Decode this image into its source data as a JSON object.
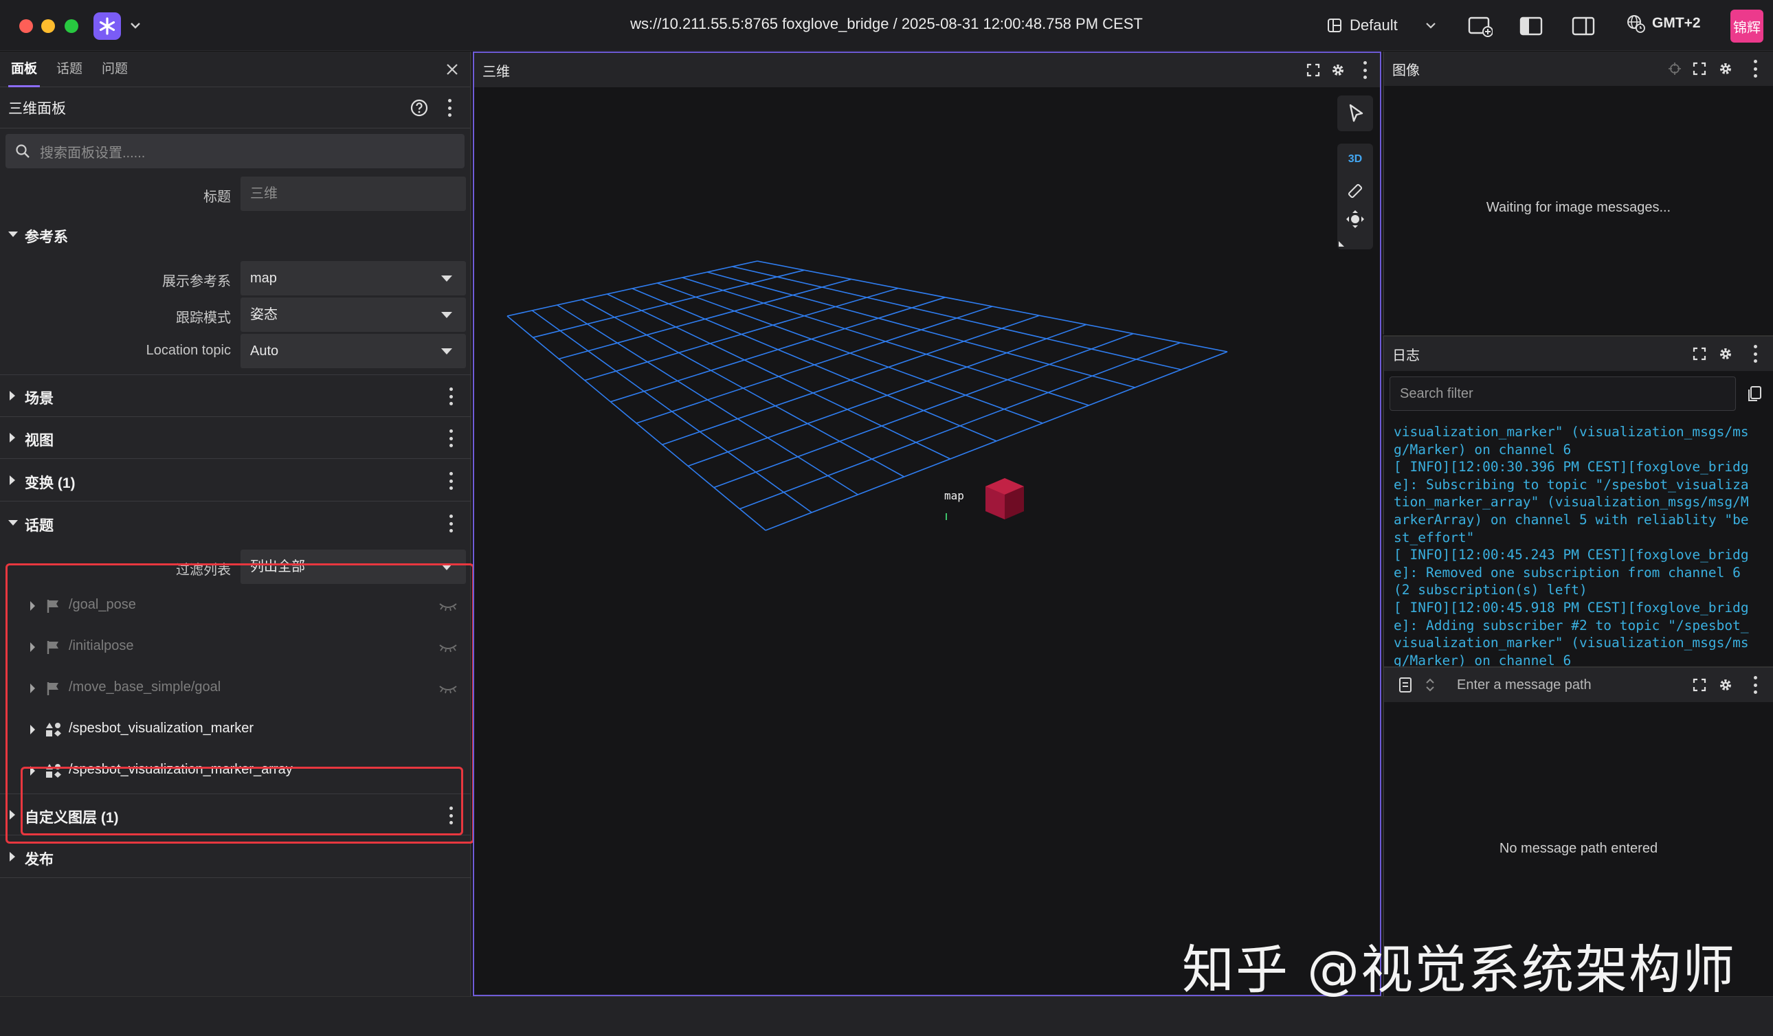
{
  "window": {
    "title": "ws://10.211.55.5:8765 foxglove_bridge / 2025-08-31 12:00:48.758 PM CEST",
    "layout_label": "Default",
    "timezone": "GMT+2",
    "user_avatar": "锦辉"
  },
  "sidebar": {
    "tabs": [
      {
        "label": "面板",
        "active": true
      },
      {
        "label": "话题",
        "active": false
      },
      {
        "label": "问题",
        "active": false
      }
    ],
    "panel_title": "三维面板",
    "search_placeholder": "搜索面板设置......",
    "title_field": {
      "label": "标题",
      "placeholder": "三维"
    },
    "frame_section": {
      "title": "参考系",
      "display_frame": {
        "label": "展示参考系",
        "value": "map"
      },
      "follow_mode": {
        "label": "跟踪模式",
        "value": "姿态"
      },
      "location_topic": {
        "label": "Location topic",
        "value": "Auto"
      }
    },
    "sections": {
      "scene": "场景",
      "view": "视图",
      "transforms": "变换 (1)",
      "topics": "话题",
      "custom_layers": "自定义图层 (1)",
      "publish": "发布"
    },
    "topic_filter": {
      "label": "过滤列表",
      "value": "列出全部"
    },
    "topics": [
      {
        "name": "/goal_pose",
        "active": false
      },
      {
        "name": "/initialpose",
        "active": false
      },
      {
        "name": "/move_base_simple/goal",
        "active": false
      },
      {
        "name": "/spesbot_visualization_marker",
        "active": true
      },
      {
        "name": "/spesbot_visualization_marker_array",
        "active": true
      }
    ]
  },
  "viewport": {
    "title": "三维",
    "mode_label": "3D",
    "frame_label": "map",
    "grid_color": "#2f7df0",
    "cube_color": "#b8163a"
  },
  "image_panel": {
    "title": "图像",
    "message": "Waiting for image messages..."
  },
  "log_panel": {
    "title": "日志",
    "search_placeholder": "Search filter",
    "lines": [
      "visualization_marker\" (visualization_msgs/ms",
      "g/Marker) on channel 6",
      "[ INFO][12:00:30.396 PM CEST][foxglove_bridg",
      "e]: Subscribing to topic \"/spesbot_visualiza",
      "tion_marker_array\" (visualization_msgs/msg/M",
      "arkerArray) on channel 5 with reliablity \"be",
      "st_effort\"",
      "[ INFO][12:00:45.243 PM CEST][foxglove_bridg",
      "e]: Removed one subscription from channel 6",
      "(2 subscription(s) left)",
      "[ INFO][12:00:45.918 PM CEST][foxglove_bridg",
      "e]: Adding subscriber #2 to topic \"/spesbot_",
      "visualization_marker\" (visualization_msgs/ms",
      "g/Marker) on channel 6"
    ]
  },
  "raw_panel": {
    "path_placeholder": "Enter a message path",
    "message": "No message path entered"
  },
  "watermark": "知乎 @视觉系统架构师"
}
